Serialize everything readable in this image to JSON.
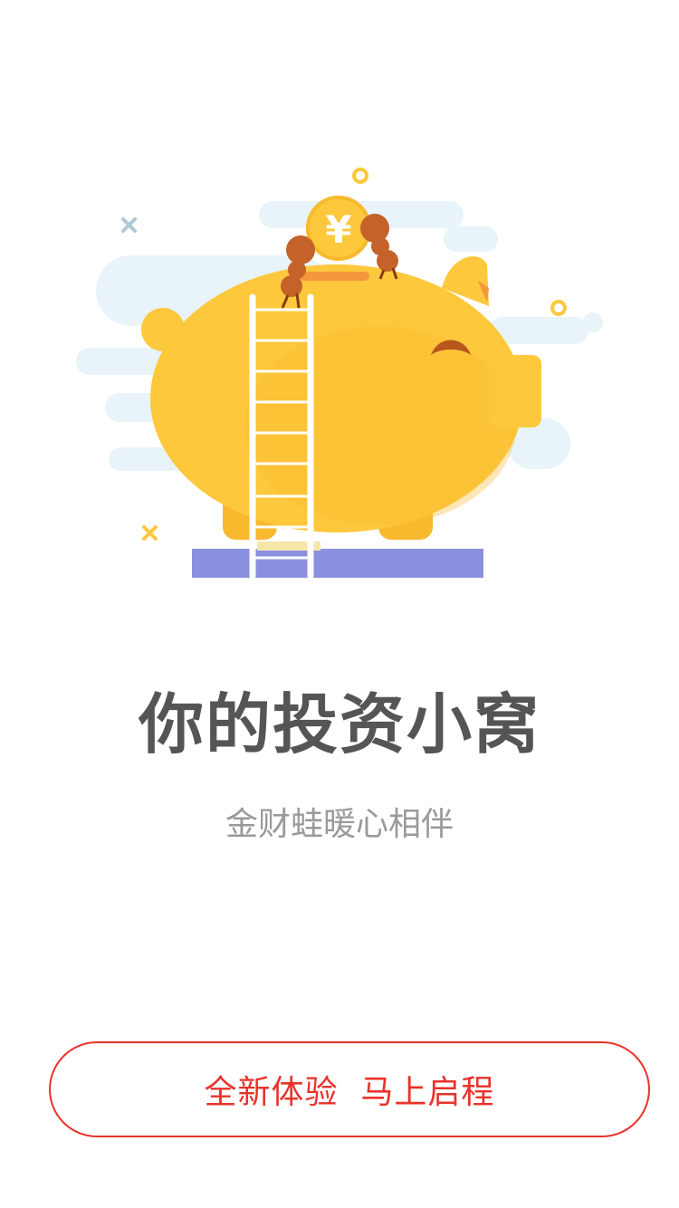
{
  "onboarding": {
    "headline": "你的投资小窝",
    "subtitle": "金财蛙暖心相伴",
    "coin_symbol": "¥",
    "cta_label": "全新体验  马上启程"
  },
  "colors": {
    "accent": "#e8332a",
    "piggy": "#fdc83c",
    "pedestal": "#8a8fe0",
    "cloud": "#e8f4fa",
    "ant": "#c5622a",
    "ladder": "#ffffff",
    "headline_text": "#555555",
    "subtitle_text": "#9a9a9a"
  },
  "icons": [
    "piggy-bank-illustration",
    "coin-icon",
    "ant-icon",
    "ladder-icon",
    "cross-decoration-icon",
    "ring-decoration-icon"
  ]
}
